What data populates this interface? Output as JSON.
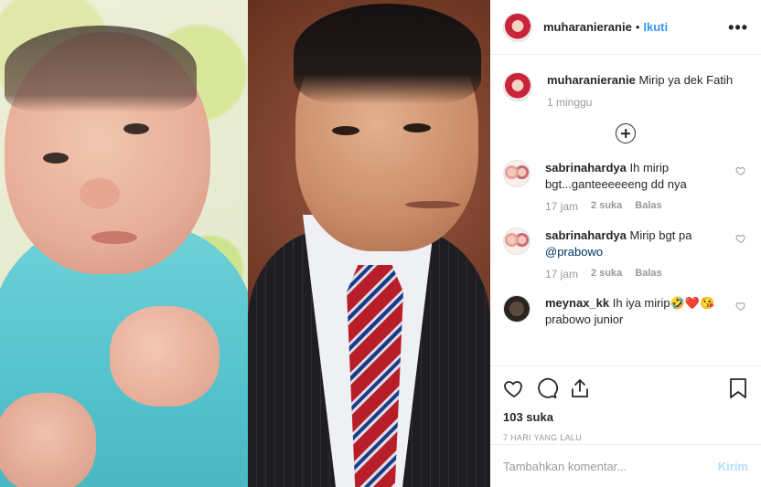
{
  "post": {
    "username": "muharanieranie",
    "dot": "•",
    "follow_label": "Ikuti",
    "more_label": "•••",
    "caption": {
      "username": "muharanieranie",
      "text": "Mirip ya dek Fatih",
      "time": "1 minggu"
    },
    "comments": [
      {
        "username": "sabrinahardya",
        "text": "Ih mirip bgt...ganteeeeeeng dd nya",
        "time": "17 jam",
        "likes": "2 suka",
        "reply": "Balas"
      },
      {
        "username": "sabrinahardya",
        "text": "Mirip bgt pa",
        "mention": "@prabowo",
        "time": "17 jam",
        "likes": "2 suka",
        "reply": "Balas"
      },
      {
        "username": "meynax_kk",
        "text": "Ih iya mirip🤣❤️😘 prabowo junior"
      }
    ],
    "likes": "103 suka",
    "posted_ago": "7 HARI YANG LALU",
    "add_comment_placeholder": "Tambahkan komentar...",
    "post_label": "Kirim"
  },
  "colors": {
    "link": "#3897f0",
    "post_disabled": "#b2dffc",
    "text": "#262626",
    "muted": "#999999"
  }
}
